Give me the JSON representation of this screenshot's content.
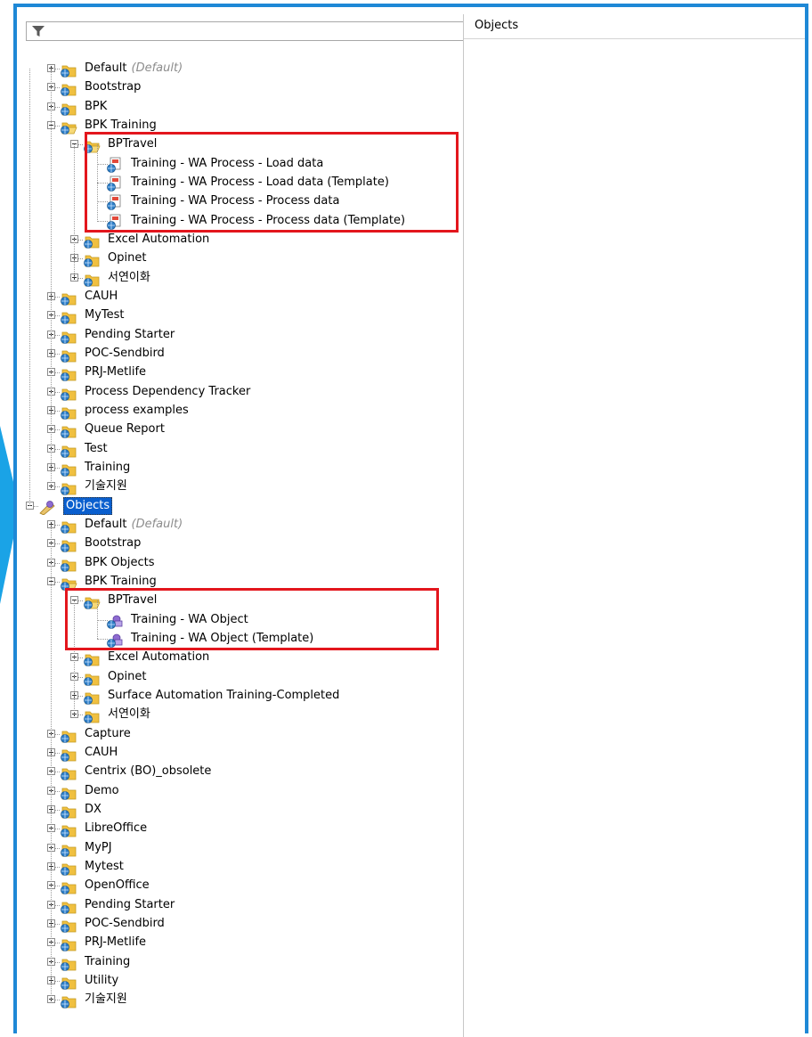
{
  "filter": {
    "icon": "funnel-icon"
  },
  "right_pane": {
    "header": "Objects"
  },
  "colors": {
    "window_border": "#1e88d6",
    "highlight": "#e3161d",
    "selection": "#0a5fce",
    "folder": "#f0c040"
  },
  "tree": [
    {
      "level": 1,
      "label": "Default",
      "suffix": "(Default)",
      "icon": "folder",
      "state": "collapsed"
    },
    {
      "level": 1,
      "label": "Bootstrap",
      "icon": "folder",
      "state": "collapsed"
    },
    {
      "level": 1,
      "label": "BPK",
      "icon": "folder",
      "state": "collapsed"
    },
    {
      "level": 1,
      "label": "BPK Training",
      "icon": "folder-open",
      "state": "expanded"
    },
    {
      "level": 2,
      "label": "BPTravel",
      "icon": "folder-open",
      "state": "expanded"
    },
    {
      "level": 3,
      "label": "Training - WA Process - Load data",
      "icon": "process"
    },
    {
      "level": 3,
      "label": "Training - WA Process - Load data (Template)",
      "icon": "process"
    },
    {
      "level": 3,
      "label": "Training - WA Process - Process data",
      "icon": "process"
    },
    {
      "level": 3,
      "label": "Training - WA Process - Process data (Template)",
      "icon": "process"
    },
    {
      "level": 2,
      "label": "Excel Automation",
      "icon": "folder",
      "state": "collapsed"
    },
    {
      "level": 2,
      "label": "Opinet",
      "icon": "folder",
      "state": "collapsed"
    },
    {
      "level": 2,
      "label": "서연이화",
      "icon": "folder",
      "state": "collapsed"
    },
    {
      "level": 1,
      "label": "CAUH",
      "icon": "folder",
      "state": "collapsed"
    },
    {
      "level": 1,
      "label": "MyTest",
      "icon": "folder",
      "state": "collapsed"
    },
    {
      "level": 1,
      "label": "Pending Starter",
      "icon": "folder",
      "state": "collapsed"
    },
    {
      "level": 1,
      "label": "POC-Sendbird",
      "icon": "folder",
      "state": "collapsed"
    },
    {
      "level": 1,
      "label": "PRJ-Metlife",
      "icon": "folder",
      "state": "collapsed"
    },
    {
      "level": 1,
      "label": "Process Dependency Tracker",
      "icon": "folder",
      "state": "collapsed"
    },
    {
      "level": 1,
      "label": "process examples",
      "icon": "folder",
      "state": "collapsed"
    },
    {
      "level": 1,
      "label": "Queue Report",
      "icon": "folder",
      "state": "collapsed"
    },
    {
      "level": 1,
      "label": "Test",
      "icon": "folder",
      "state": "collapsed"
    },
    {
      "level": 1,
      "label": "Training",
      "icon": "folder",
      "state": "collapsed"
    },
    {
      "level": 1,
      "label": "기술지원",
      "icon": "folder",
      "state": "collapsed"
    },
    {
      "level": 0,
      "label": "Objects",
      "icon": "objects-root",
      "state": "expanded",
      "selected": true
    },
    {
      "level": 1,
      "label": "Default",
      "suffix": "(Default)",
      "icon": "folder",
      "state": "collapsed"
    },
    {
      "level": 1,
      "label": "Bootstrap",
      "icon": "folder",
      "state": "collapsed"
    },
    {
      "level": 1,
      "label": "BPK Objects",
      "icon": "folder",
      "state": "collapsed"
    },
    {
      "level": 1,
      "label": "BPK Training",
      "icon": "folder-open",
      "state": "expanded"
    },
    {
      "level": 2,
      "label": "BPTravel",
      "icon": "folder-open",
      "state": "expanded"
    },
    {
      "level": 3,
      "label": "Training - WA Object",
      "icon": "object"
    },
    {
      "level": 3,
      "label": "Training - WA Object (Template)",
      "icon": "object"
    },
    {
      "level": 2,
      "label": "Excel Automation",
      "icon": "folder",
      "state": "collapsed"
    },
    {
      "level": 2,
      "label": "Opinet",
      "icon": "folder",
      "state": "collapsed"
    },
    {
      "level": 2,
      "label": "Surface Automation Training-Completed",
      "icon": "folder",
      "state": "collapsed"
    },
    {
      "level": 2,
      "label": "서연이화",
      "icon": "folder",
      "state": "collapsed"
    },
    {
      "level": 1,
      "label": "Capture",
      "icon": "folder",
      "state": "collapsed"
    },
    {
      "level": 1,
      "label": "CAUH",
      "icon": "folder",
      "state": "collapsed"
    },
    {
      "level": 1,
      "label": "Centrix (BO)_obsolete",
      "icon": "folder",
      "state": "collapsed"
    },
    {
      "level": 1,
      "label": "Demo",
      "icon": "folder",
      "state": "collapsed"
    },
    {
      "level": 1,
      "label": "DX",
      "icon": "folder",
      "state": "collapsed"
    },
    {
      "level": 1,
      "label": "LibreOffice",
      "icon": "folder",
      "state": "collapsed"
    },
    {
      "level": 1,
      "label": "MyPJ",
      "icon": "folder",
      "state": "collapsed"
    },
    {
      "level": 1,
      "label": "Mytest",
      "icon": "folder",
      "state": "collapsed"
    },
    {
      "level": 1,
      "label": "OpenOffice",
      "icon": "folder",
      "state": "collapsed"
    },
    {
      "level": 1,
      "label": "Pending Starter",
      "icon": "folder",
      "state": "collapsed"
    },
    {
      "level": 1,
      "label": "POC-Sendbird",
      "icon": "folder",
      "state": "collapsed"
    },
    {
      "level": 1,
      "label": "PRJ-Metlife",
      "icon": "folder",
      "state": "collapsed"
    },
    {
      "level": 1,
      "label": "Training",
      "icon": "folder",
      "state": "collapsed"
    },
    {
      "level": 1,
      "label": "Utility",
      "icon": "folder",
      "state": "collapsed"
    },
    {
      "level": 1,
      "label": "기술지원",
      "icon": "folder",
      "state": "collapsed"
    }
  ]
}
